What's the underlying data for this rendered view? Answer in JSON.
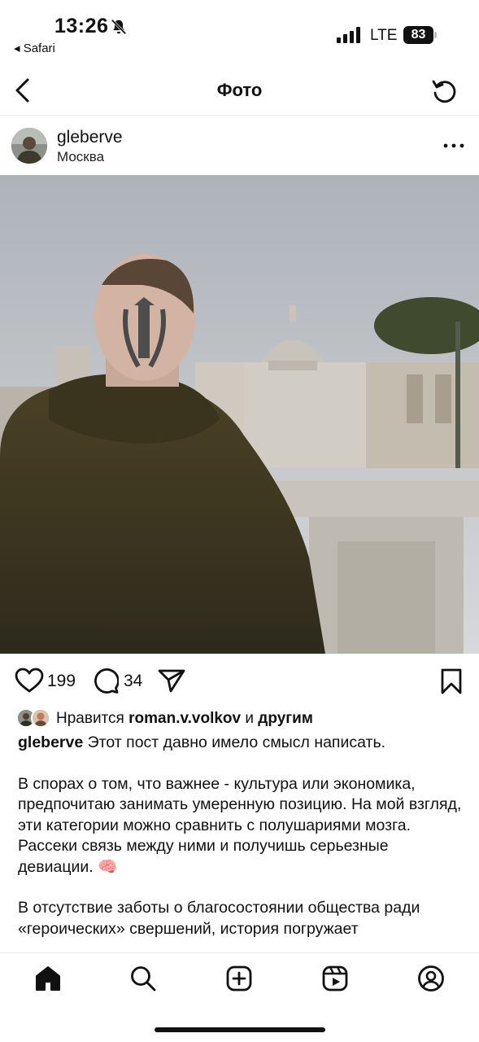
{
  "status_bar": {
    "time": "13:26",
    "back_app": "◂ Safari",
    "network": "LTE",
    "battery": "83"
  },
  "nav": {
    "title": "Фото",
    "back_icon": "chevron-left-icon",
    "refresh_icon": "refresh-icon"
  },
  "post": {
    "username": "gleberve",
    "location": "Москва",
    "more_icon": "more-icon"
  },
  "actions": {
    "likes_count": "199",
    "comments_count": "34"
  },
  "likes": {
    "prefix": "Нравится ",
    "user": "roman.v.volkov",
    "middle": " и ",
    "others": "другим"
  },
  "caption": {
    "username": "gleberve",
    "first_line": " Этот пост давно имело смысл написать.",
    "paragraph2": "В спорах о том, что важнее - культура или экономика, предпочитаю занимать умеренную позицию. На мой взгляд, эти категории можно сравнить с полушариями мозга. Рассеки связь между ними и получишь серьезные девиации. 🧠",
    "paragraph3": "В отсутствие заботы о благосостоянии общества ради «героических» свершений, история погружает"
  },
  "tabbar": {
    "items": [
      "home-icon",
      "search-icon",
      "create-icon",
      "reels-icon",
      "profile-icon"
    ]
  },
  "colors": {
    "text": "#111111",
    "divider": "#ececec",
    "background": "#ffffff"
  }
}
